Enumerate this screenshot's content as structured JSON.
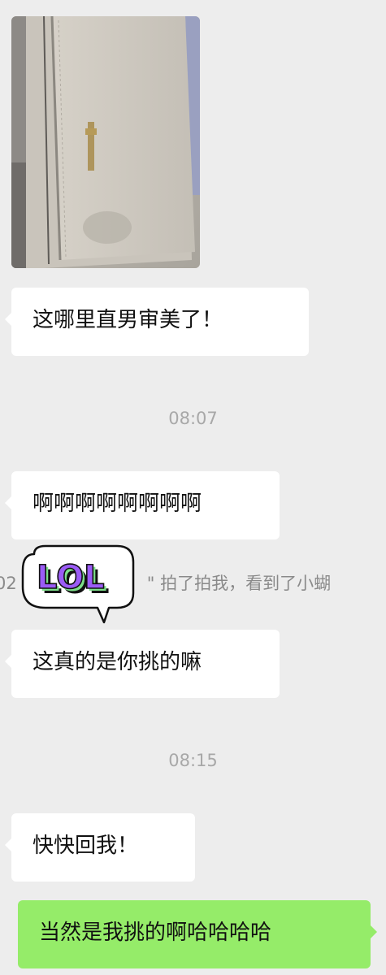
{
  "messages": [
    {
      "type": "image",
      "side": "left",
      "alt": "wallet photo"
    },
    {
      "type": "text",
      "side": "left",
      "text": "这哪里直男审美了！"
    },
    {
      "type": "time",
      "text": "08:07"
    },
    {
      "type": "text",
      "side": "left",
      "text": "啊啊啊啊啊啊啊啊"
    },
    {
      "type": "system",
      "text_start": "02",
      "text_end": "\" 拍了拍我，看到了小蝴"
    },
    {
      "type": "sticker",
      "text": "LOL"
    },
    {
      "type": "text",
      "side": "left",
      "text": "这真的是你挑的嘛"
    },
    {
      "type": "time",
      "text": "08:15"
    },
    {
      "type": "text",
      "side": "left",
      "text": "快快回我！"
    },
    {
      "type": "text",
      "side": "right",
      "text": "当然是我挑的啊哈哈哈哈"
    }
  ],
  "colors": {
    "background": "#ededed",
    "bubble_received": "#ffffff",
    "bubble_sent": "#95ec69",
    "timestamp": "#a8a8a8",
    "sticker_green": "#7de08a",
    "sticker_purple": "#9b5cf6"
  }
}
